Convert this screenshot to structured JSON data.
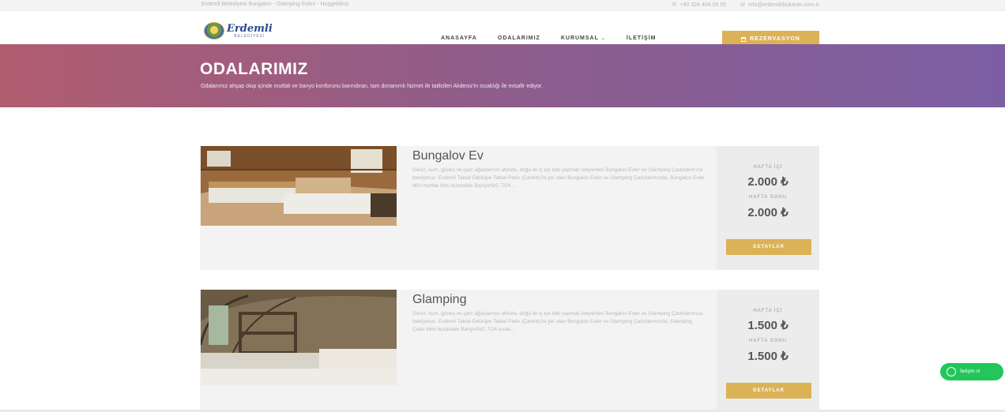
{
  "topbar": {
    "welcome": "Erdemli Belediyesi Bungalov - Glamping Evleri - Hoşgeldiniz",
    "phone": "+90 324 404 05 55",
    "email": "info@erdemlirbulutum.com.tr"
  },
  "nav": {
    "logo_text": "Erdemli",
    "logo_sub": "BELEDİYESİ",
    "items": [
      {
        "label": "ANASAYFA"
      },
      {
        "label": "ODALARIMIZ"
      },
      {
        "label": "KURUMSAL"
      },
      {
        "label": "İLETİŞİM"
      }
    ],
    "rez_label": "REZERVASYON"
  },
  "hero": {
    "title": "ODALARIMIZ",
    "subtitle": "Odalarımız ahşap olup içinde mutfak ve banyo konforunu barındıran, tam donanımlı hizmet ile tatilcileri Akdeniz'in sıcaklığı ile misafir ediyor."
  },
  "rooms": [
    {
      "title": "Bungalov Ev",
      "description": "Deniz, kum, güneş ve çam ağaçlarının altında, doğa ile iç içe tatil yapmak isteyenleri Bungalov Evler ve Glamping Çadırlarımıza bekliyoruz. Erdemli Tabiat Ödülüpe Tabiat Parkı (Çamlık)'ta yer alan Bungalov Evler ve Glamping Çadırlarımızda, Bungalov Evler Mini mutfak Mini buzdolabı Banyo/WC 7/24...",
      "weekday_label": "HAFTA İÇİ",
      "weekday_price": "2.000 ₺",
      "weekend_label": "HAFTA SONU",
      "weekend_price": "2.000 ₺",
      "button": "DETAYLAR"
    },
    {
      "title": "Glamping",
      "description": "Deniz, kum, güneş ve çam ağaçlarının altında, doğa ile iç içe tatil yapmak isteyenleri Bungalov Evler ve Glamping Çadırlarımıza bekliyoruz. Erdemli Tabiat Ödülüpe Tabiat Parkı (Çamlık)'ta yer alan Bungalov Evler ve Glamping Çadırlarımızda, Glamping Çadır Mini buzdolabı Banyo/WC 7/24 sıcak...",
      "weekday_label": "HAFTA İÇİ",
      "weekday_price": "1.500 ₺",
      "weekend_label": "HAFTA SONU",
      "weekend_price": "1.500 ₺",
      "button": "DETAYLAR"
    }
  ],
  "whatsapp": {
    "label": "İletişim ol"
  },
  "colors": {
    "accent": "#dcb257",
    "hero_start": "#b15d70",
    "hero_end": "#7b5ea3",
    "whatsapp": "#22c65a"
  }
}
